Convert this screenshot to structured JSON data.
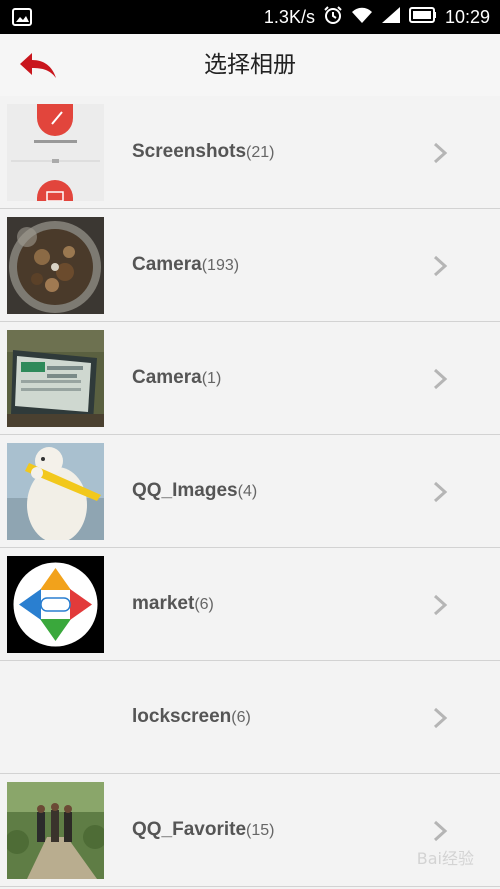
{
  "status_bar": {
    "network_speed": "1.3K/s",
    "time": "10:29"
  },
  "header": {
    "title": "选择相册"
  },
  "albums": [
    {
      "name": "Screenshots",
      "count": "(21)"
    },
    {
      "name": "Camera",
      "count": "(193)"
    },
    {
      "name": "Camera",
      "count": "(1)"
    },
    {
      "name": "QQ_Images",
      "count": "(4)"
    },
    {
      "name": "market",
      "count": "(6)"
    },
    {
      "name": "lockscreen",
      "count": "(6)"
    },
    {
      "name": "QQ_Favorite",
      "count": "(15)"
    }
  ],
  "icons": {
    "back": "back-arrow-icon",
    "chevron": "chevron-right-icon",
    "alarm": "alarm-icon",
    "wifi": "wifi-icon",
    "signal": "signal-icon",
    "battery": "battery-icon",
    "gallery": "gallery-icon"
  },
  "colors": {
    "back_arrow": "#c9161d",
    "chevron": "#b5b5b5",
    "status_bar": "#000000",
    "header_bg": "#f6f6f6"
  },
  "watermark": "Bai经验"
}
